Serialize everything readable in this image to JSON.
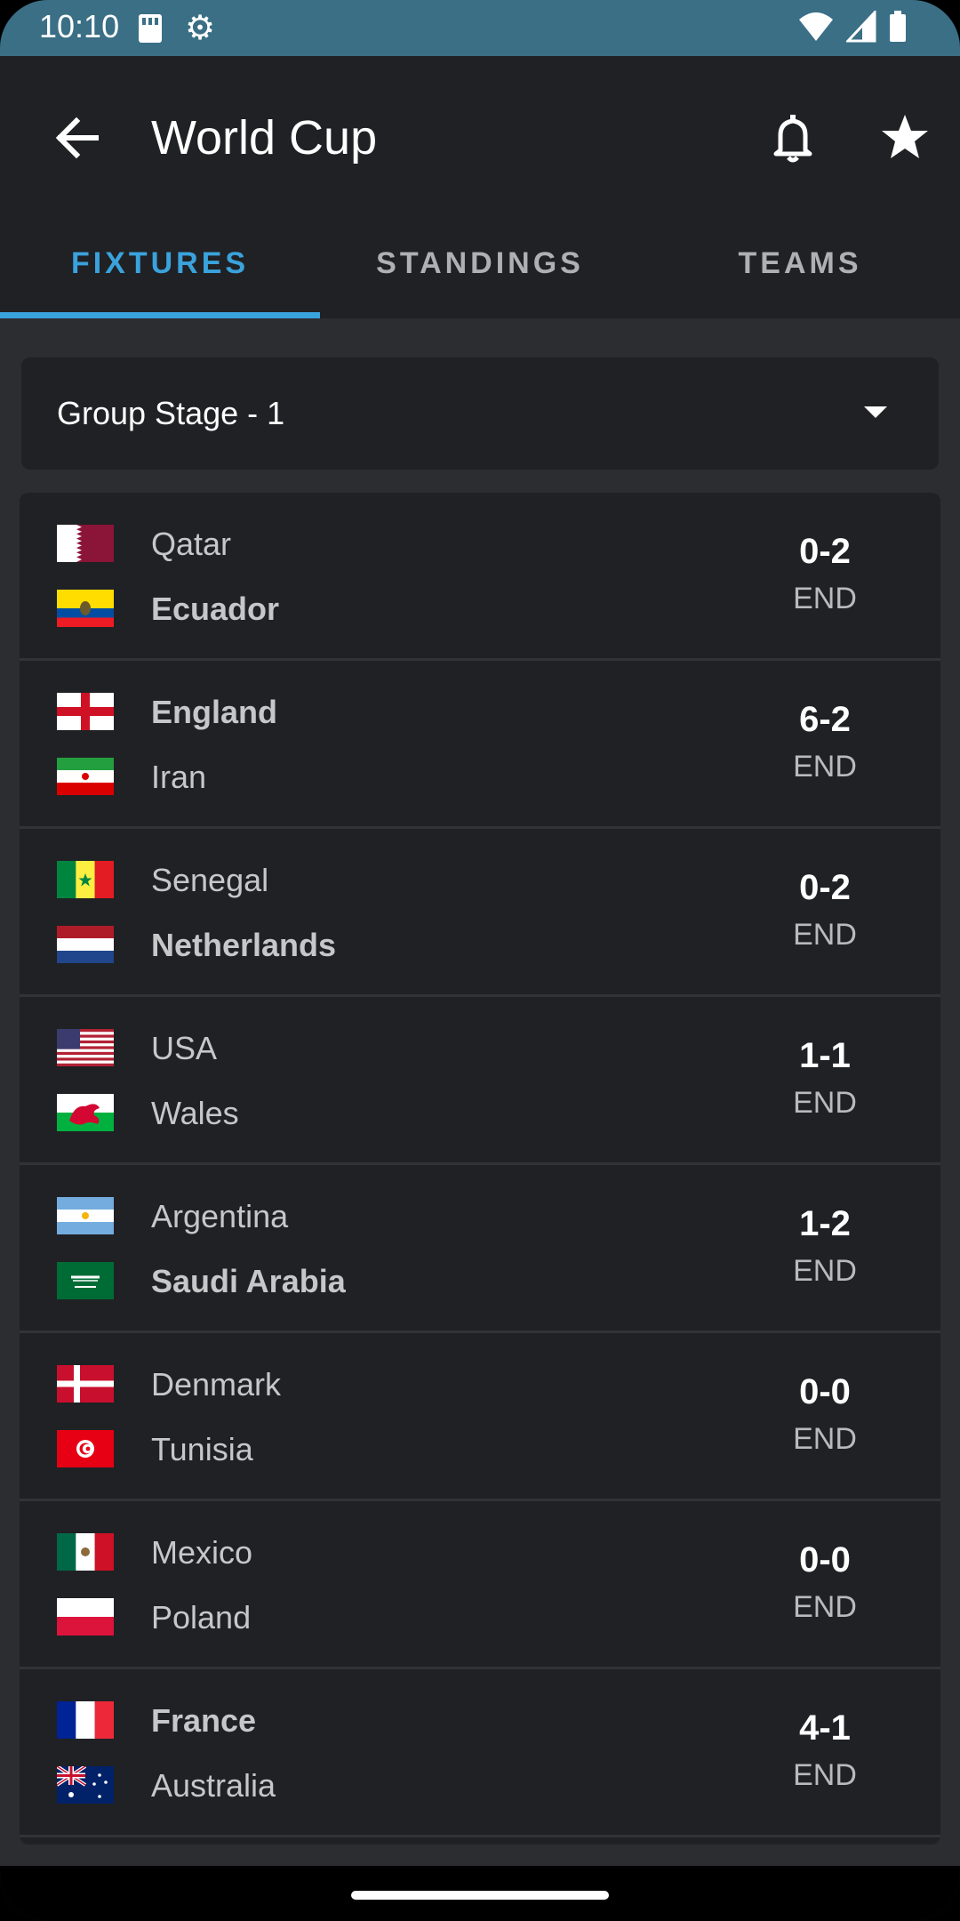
{
  "status_bar": {
    "time": "10:10"
  },
  "app_bar": {
    "title": "World Cup"
  },
  "tabs": [
    {
      "label": "FIXTURES",
      "active": true
    },
    {
      "label": "STANDINGS",
      "active": false
    },
    {
      "label": "TEAMS",
      "active": false
    }
  ],
  "stage_select": {
    "value": "Group Stage - 1"
  },
  "matches": [
    {
      "home": {
        "name": "Qatar",
        "flag": "qatar-flag",
        "winner": false
      },
      "away": {
        "name": "Ecuador",
        "flag": "ecuador-flag",
        "winner": true
      },
      "score": "0-2",
      "status": "END"
    },
    {
      "home": {
        "name": "England",
        "flag": "england-flag",
        "winner": true
      },
      "away": {
        "name": "Iran",
        "flag": "iran-flag",
        "winner": false
      },
      "score": "6-2",
      "status": "END"
    },
    {
      "home": {
        "name": "Senegal",
        "flag": "senegal-flag",
        "winner": false
      },
      "away": {
        "name": "Netherlands",
        "flag": "netherlands-flag",
        "winner": true
      },
      "score": "0-2",
      "status": "END"
    },
    {
      "home": {
        "name": "USA",
        "flag": "usa-flag",
        "winner": false
      },
      "away": {
        "name": "Wales",
        "flag": "wales-flag",
        "winner": false
      },
      "score": "1-1",
      "status": "END"
    },
    {
      "home": {
        "name": "Argentina",
        "flag": "argentina-flag",
        "winner": false
      },
      "away": {
        "name": "Saudi Arabia",
        "flag": "saudi-arabia-flag",
        "winner": true
      },
      "score": "1-2",
      "status": "END"
    },
    {
      "home": {
        "name": "Denmark",
        "flag": "denmark-flag",
        "winner": false
      },
      "away": {
        "name": "Tunisia",
        "flag": "tunisia-flag",
        "winner": false
      },
      "score": "0-0",
      "status": "END"
    },
    {
      "home": {
        "name": "Mexico",
        "flag": "mexico-flag",
        "winner": false
      },
      "away": {
        "name": "Poland",
        "flag": "poland-flag",
        "winner": false
      },
      "score": "0-0",
      "status": "END"
    },
    {
      "home": {
        "name": "France",
        "flag": "france-flag",
        "winner": true
      },
      "away": {
        "name": "Australia",
        "flag": "australia-flag",
        "winner": false
      },
      "score": "4-1",
      "status": "END"
    }
  ],
  "colors": {
    "accent": "#3aa2dc",
    "status_bar": "#3a6f86",
    "surface": "#202124",
    "background": "#2c2d30"
  }
}
